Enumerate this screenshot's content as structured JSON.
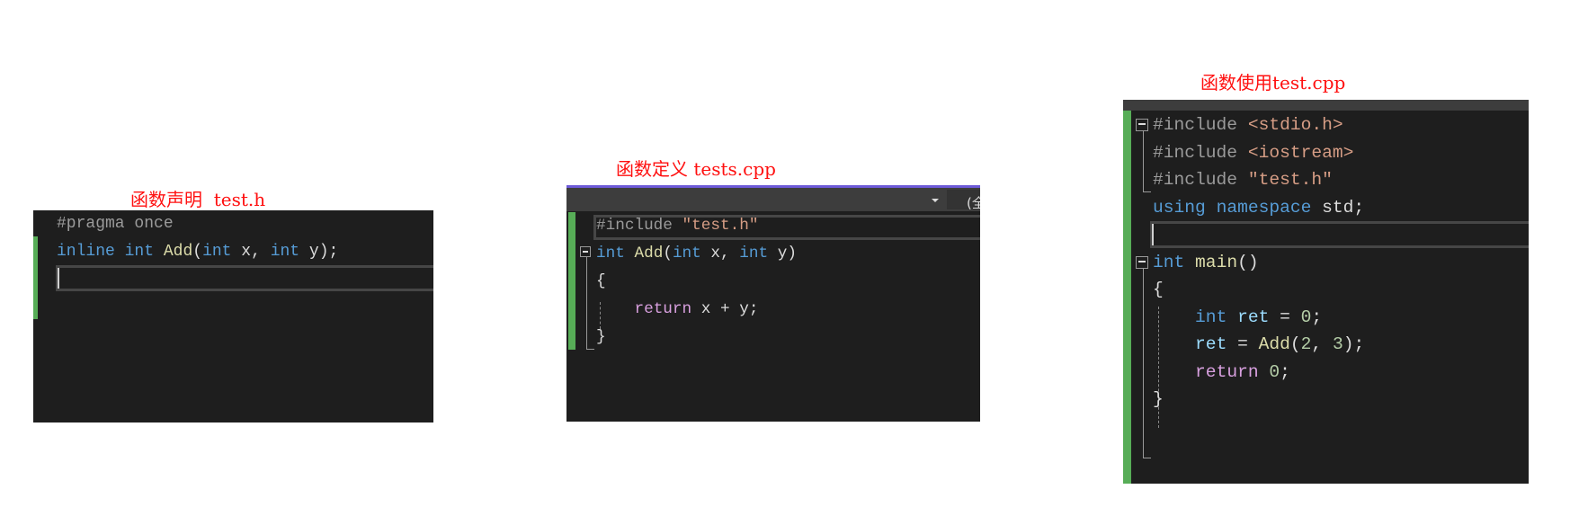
{
  "colors": {
    "background": "#1e1e1e",
    "change_bar": "#57ad57",
    "title": "#ff1010",
    "keyword": "#569cd6",
    "function": "#dcdcaa",
    "string": "#d69d85",
    "preprocessor": "#9b9b9b",
    "control": "#d8a0df",
    "number": "#b5cea8",
    "variable": "#9cdcfe"
  },
  "panels": [
    {
      "title": "函数声明  test.h",
      "lines": [
        [
          [
            "pp",
            "#pragma once"
          ]
        ],
        [
          [
            "kw",
            "inline"
          ],
          [
            "txt",
            " "
          ],
          [
            "kw",
            "int"
          ],
          [
            "txt",
            " "
          ],
          [
            "fn",
            "Add"
          ],
          [
            "txt",
            "("
          ],
          [
            "kw",
            "int"
          ],
          [
            "txt",
            " x, "
          ],
          [
            "kw",
            "int"
          ],
          [
            "txt",
            " y);"
          ]
        ]
      ]
    },
    {
      "title": "函数定义 tests.cpp",
      "toolbar_text": "(全",
      "lines": [
        [
          [
            "pp",
            "#include "
          ],
          [
            "str",
            "\"test.h\""
          ]
        ],
        [
          [
            "kw",
            "int"
          ],
          [
            "txt",
            " "
          ],
          [
            "fn",
            "Add"
          ],
          [
            "txt",
            "("
          ],
          [
            "kw",
            "int"
          ],
          [
            "txt",
            " x, "
          ],
          [
            "kw",
            "int"
          ],
          [
            "txt",
            " y)"
          ]
        ],
        [
          [
            "txt",
            "{"
          ]
        ],
        [
          [
            "txt",
            "    "
          ],
          [
            "ctl",
            "return"
          ],
          [
            "txt",
            " x + y;"
          ]
        ],
        [
          [
            "txt",
            "}"
          ]
        ]
      ]
    },
    {
      "title": "函数使用test.cpp",
      "lines": [
        [
          [
            "pp",
            "#include "
          ],
          [
            "str",
            "<stdio.h>"
          ]
        ],
        [
          [
            "pp",
            "#include "
          ],
          [
            "str",
            "<iostream>"
          ]
        ],
        [
          [
            "pp",
            "#include "
          ],
          [
            "str",
            "\"test.h\""
          ]
        ],
        [
          [
            "kw",
            "using"
          ],
          [
            "txt",
            " "
          ],
          [
            "kw",
            "namespace"
          ],
          [
            "txt",
            " std;"
          ]
        ],
        [
          [
            "txt",
            ""
          ]
        ],
        [
          [
            "kw",
            "int"
          ],
          [
            "txt",
            " "
          ],
          [
            "fn",
            "main"
          ],
          [
            "txt",
            "()"
          ]
        ],
        [
          [
            "txt",
            "{"
          ]
        ],
        [
          [
            "txt",
            "    "
          ],
          [
            "kw",
            "int"
          ],
          [
            "txt",
            " "
          ],
          [
            "var",
            "ret"
          ],
          [
            "txt",
            " = "
          ],
          [
            "num",
            "0"
          ],
          [
            "txt",
            ";"
          ]
        ],
        [
          [
            "txt",
            "    "
          ],
          [
            "var",
            "ret"
          ],
          [
            "txt",
            " = "
          ],
          [
            "fn",
            "Add"
          ],
          [
            "txt",
            "("
          ],
          [
            "num",
            "2"
          ],
          [
            "txt",
            ", "
          ],
          [
            "num",
            "3"
          ],
          [
            "txt",
            ");"
          ]
        ],
        [
          [
            "txt",
            "    "
          ],
          [
            "ctl",
            "return"
          ],
          [
            "txt",
            " "
          ],
          [
            "num",
            "0"
          ],
          [
            "txt",
            ";"
          ]
        ],
        [
          [
            "txt",
            "}"
          ]
        ]
      ]
    }
  ]
}
